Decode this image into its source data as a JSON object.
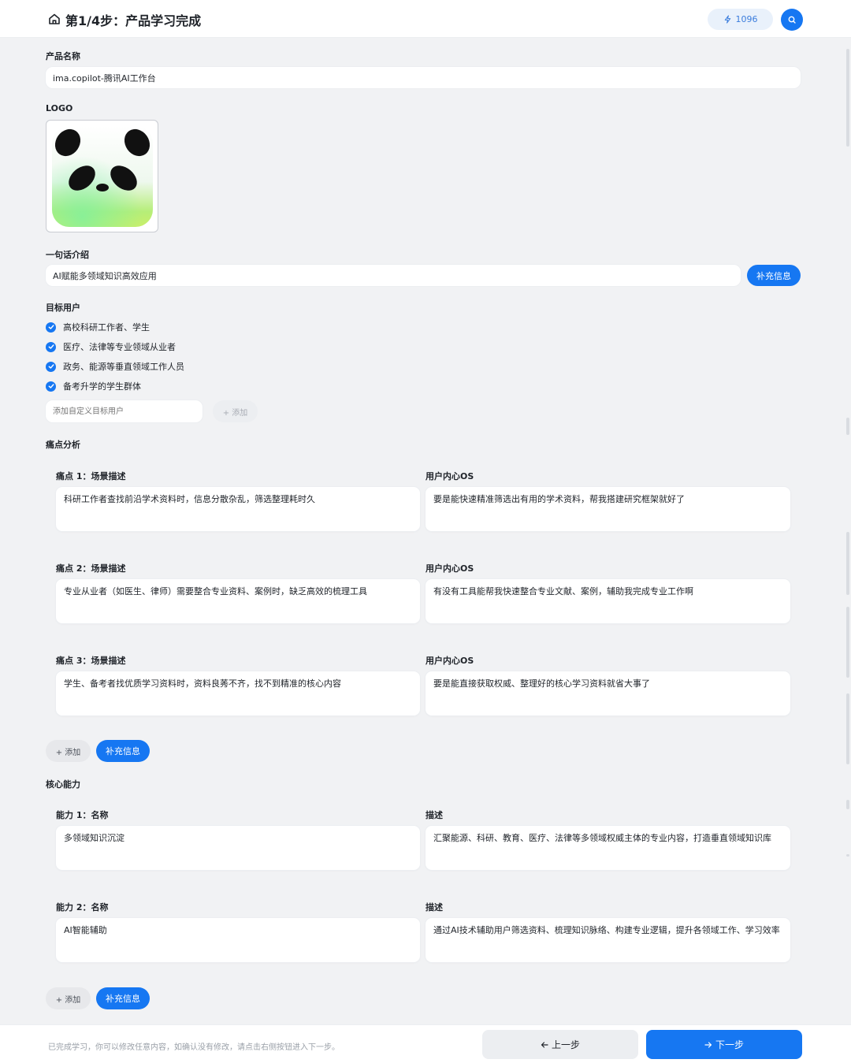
{
  "header": {
    "title": "第1/4步：产品学习完成",
    "credits": "1096",
    "home_icon": "home-icon",
    "credits_icon": "lightning-icon",
    "avatar_icon": "search-icon"
  },
  "product": {
    "name_label": "产品名称",
    "name_value": "ima.copilot-腾讯AI工作台",
    "logo_label": "LOGO",
    "intro_label": "一句话介绍",
    "intro_value": "AI赋能多领域知识高效应用",
    "intro_supplement": "补充信息"
  },
  "target_users": {
    "label": "目标用户",
    "items": [
      "高校科研工作者、学生",
      "医疗、法律等专业领域从业者",
      "政务、能源等垂直领域工作人员",
      "备考升学的学生群体"
    ],
    "custom_placeholder": "添加自定义目标用户",
    "add_label": "+ 添加"
  },
  "pain_points": {
    "label": "痛点分析",
    "items": [
      {
        "title": "痛点 1：场景描述",
        "scene": "科研工作者查找前沿学术资料时，信息分散杂乱，筛选整理耗时久",
        "os_title": "用户内心OS",
        "os": "要是能快速精准筛选出有用的学术资料，帮我搭建研究框架就好了"
      },
      {
        "title": "痛点 2：场景描述",
        "scene": "专业从业者（如医生、律师）需要整合专业资料、案例时，缺乏高效的梳理工具",
        "os_title": "用户内心OS",
        "os": "有没有工具能帮我快速整合专业文献、案例，辅助我完成专业工作啊"
      },
      {
        "title": "痛点 3：场景描述",
        "scene": "学生、备考者找优质学习资料时，资料良莠不齐，找不到精准的核心内容",
        "os_title": "用户内心OS",
        "os": "要是能直接获取权威、整理好的核心学习资料就省大事了"
      }
    ],
    "add_label": "+ 添加",
    "supplement_label": "补充信息"
  },
  "capabilities": {
    "label": "核心能力",
    "items": [
      {
        "title": "能力 1：名称",
        "name": "多领域知识沉淀",
        "desc_title": "描述",
        "desc": "汇聚能源、科研、教育、医疗、法律等多领域权威主体的专业内容，打造垂直领域知识库"
      },
      {
        "title": "能力 2：名称",
        "name": "AI智能辅助",
        "desc_title": "描述",
        "desc": "通过AI技术辅助用户筛选资料、梳理知识脉络、构建专业逻辑，提升各领域工作、学习效率"
      }
    ],
    "add_label": "+ 添加",
    "supplement_label": "补充信息"
  },
  "footer": {
    "note": "已完成学习，你可以修改任意内容，如确认没有修改，请点击右侧按钮进入下一步。",
    "prev_label": "上一步",
    "next_label": "下一步"
  },
  "colors": {
    "accent": "#1677f2",
    "background": "#f1f2f4"
  }
}
